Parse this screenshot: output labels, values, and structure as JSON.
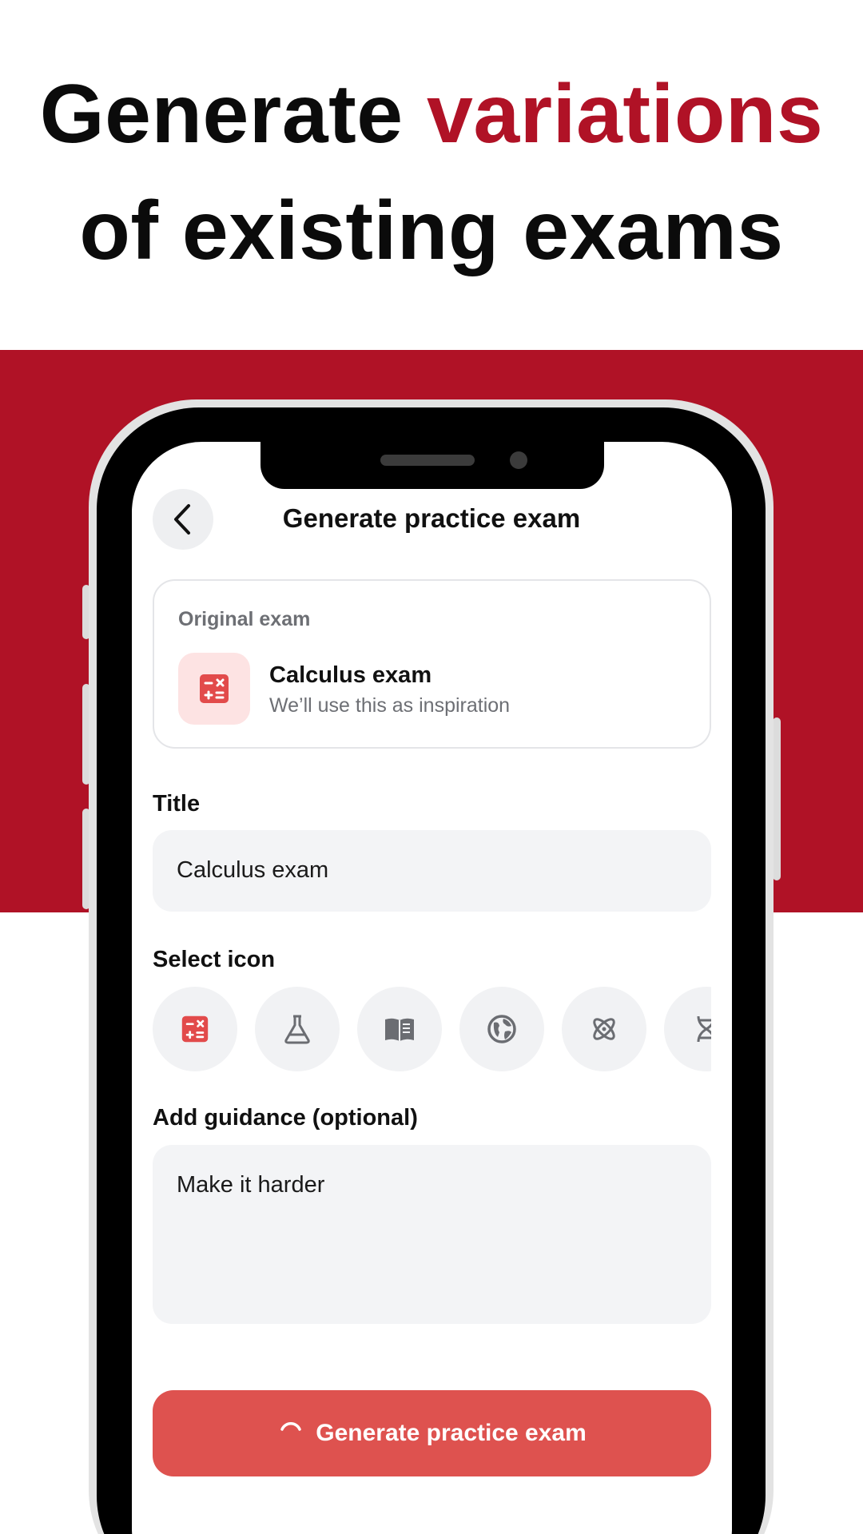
{
  "headline": {
    "part1": "Generate ",
    "accent": "variations",
    "line2": "of existing exams"
  },
  "colors": {
    "brand_red": "#b01226",
    "button_red": "#de524f",
    "icon_red": "#e24b4b",
    "field_bg": "#f3f4f6"
  },
  "screen": {
    "title": "Generate practice exam",
    "back_icon": "chevron-left-icon",
    "original_exam": {
      "label": "Original exam",
      "icon": "calculator-icon",
      "name": "Calculus exam",
      "subtitle": "We’ll use this as inspiration"
    },
    "title_field": {
      "label": "Title",
      "value": "Calculus exam"
    },
    "select_icon": {
      "label": "Select icon",
      "icons": [
        "calculator-icon",
        "flask-icon",
        "book-icon",
        "globe-icon",
        "atom-icon",
        "dna-icon"
      ],
      "selected": "calculator-icon"
    },
    "guidance": {
      "label": "Add guidance (optional)",
      "value": "Make it harder"
    },
    "generate_button": {
      "label": "Generate practice exam",
      "loading_icon": "spinner-icon"
    }
  }
}
